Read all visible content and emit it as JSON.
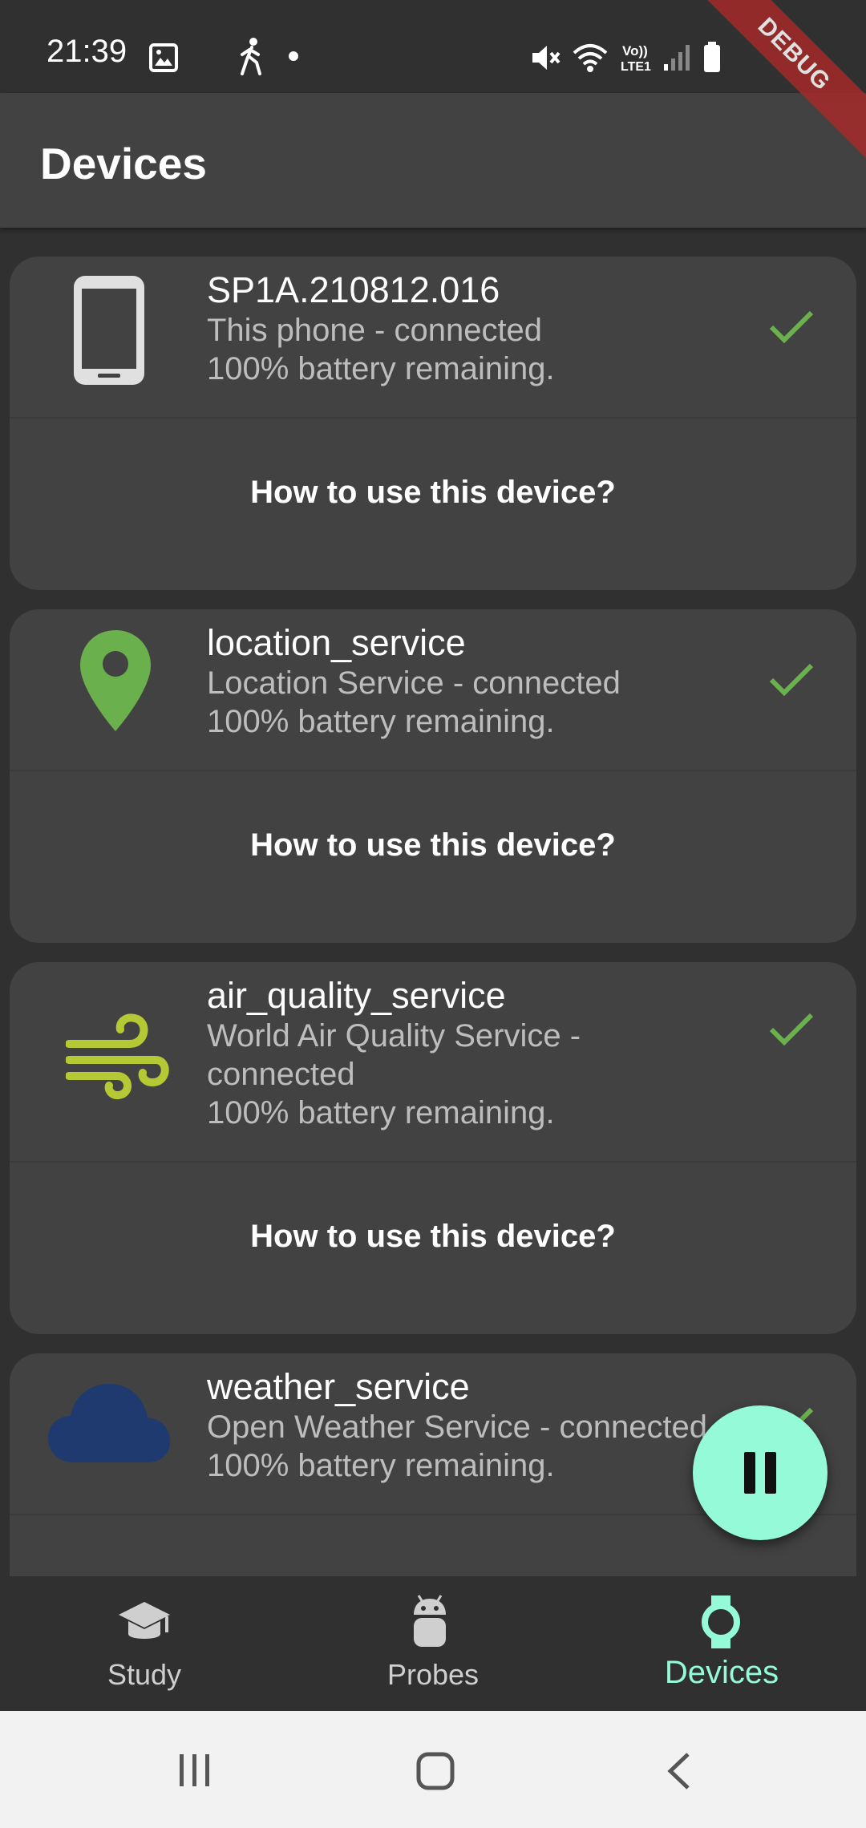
{
  "status_bar": {
    "time": "21:39",
    "icons": [
      "image-icon",
      "walking-icon",
      "dot-icon",
      "mute-icon",
      "wifi-icon",
      "volte-icon",
      "signal-icon",
      "battery-icon"
    ]
  },
  "debug_banner": "DEBUG",
  "app_bar": {
    "title": "Devices"
  },
  "devices": [
    {
      "icon": "phone-icon",
      "name": "SP1A.210812.016",
      "status": "This phone - connected",
      "battery": "100% battery remaining.",
      "howto": "How to use this device?"
    },
    {
      "icon": "location-pin-icon",
      "name": "location_service",
      "status": "Location Service - connected",
      "battery": "100% battery remaining.",
      "howto": "How to use this device?"
    },
    {
      "icon": "wind-icon",
      "name": "air_quality_service",
      "status_line1": "World Air Quality Service -",
      "status_line2": "connected",
      "battery": "100% battery remaining.",
      "howto": "How to use this device?"
    },
    {
      "icon": "cloud-icon",
      "name": "weather_service",
      "status": "Open Weather Service - connected",
      "battery": "100% battery remaining."
    }
  ],
  "colors": {
    "accent": "#95fad8",
    "check": "#6ab04c",
    "location_pin": "#6ab04c",
    "wind": "#b5c934",
    "cloud": "#1e3a6e"
  },
  "fab": {
    "icon": "pause-icon"
  },
  "bottom_nav": [
    {
      "label": "Study",
      "icon": "school-icon",
      "active": false
    },
    {
      "label": "Probes",
      "icon": "android-icon",
      "active": false
    },
    {
      "label": "Devices",
      "icon": "watch-icon",
      "active": true
    }
  ],
  "system_nav": [
    "recents-icon",
    "home-icon",
    "back-icon"
  ]
}
